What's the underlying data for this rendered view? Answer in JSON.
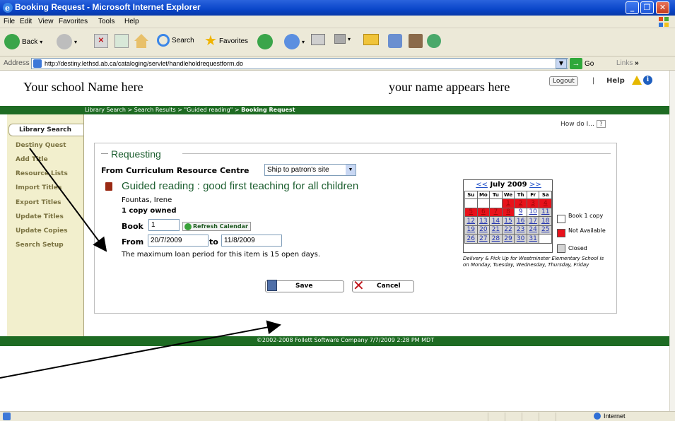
{
  "window": {
    "title": "Booking Request - Microsoft Internet Explorer",
    "controls": [
      "_",
      "❐",
      "✕"
    ]
  },
  "menu": [
    "File",
    "Edit",
    "View",
    "Favorites",
    "Tools",
    "Help"
  ],
  "toolbar": {
    "back": "Back",
    "search": "Search",
    "favorites": "Favorites"
  },
  "address": {
    "label": "Address",
    "url": "http://destiny.lethsd.ab.ca/cataloging/servlet/handleholdrequestform.do",
    "go": "Go",
    "links": "Links"
  },
  "header": {
    "school_name": "Your school Name here",
    "user_name": "your name appears here",
    "logout": "Logout",
    "separator": "|",
    "help": "Help"
  },
  "breadcrumb": {
    "trail": "Library Search > Search Results > \"Guided reading\" > ",
    "current": "Booking Request"
  },
  "sidebar": {
    "active": "Library Search",
    "items": [
      "Destiny Quest",
      "Add Title",
      "Resource Lists",
      "Import Titles",
      "Export Titles",
      "Update Titles",
      "Update Copies",
      "Search Setup"
    ]
  },
  "how_do_i": "How do I...",
  "how_do_i_icon": "?",
  "form": {
    "section": "Requesting",
    "from_curriculum": "From Curriculum Resource Centre",
    "ship_option": "Ship to patron's site",
    "book_title": "Guided reading : good first teaching for all children",
    "author": "Fountas, Irene",
    "copies_owned": "1 copy owned",
    "book_label": "Book",
    "book_value": "1",
    "refresh_label": "Refresh Calendar",
    "from_label": "From",
    "from_value": "20/7/2009",
    "to_label": "to",
    "to_value": "11/8/2009",
    "loan_message": "The maximum loan period for this item is 15 open days.",
    "save": "Save",
    "cancel": "Cancel"
  },
  "calendar": {
    "prev": "<<",
    "month": "July 2009",
    "next": ">>",
    "weekdays": [
      "Su",
      "Mo",
      "Tu",
      "We",
      "Th",
      "Fr",
      "Sa"
    ],
    "weeks": [
      [
        {
          "d": "",
          "s": "emp"
        },
        {
          "d": "",
          "s": "emp"
        },
        {
          "d": "",
          "s": "emp"
        },
        {
          "d": "1",
          "s": "na"
        },
        {
          "d": "2",
          "s": "na"
        },
        {
          "d": "3",
          "s": "na"
        },
        {
          "d": "4",
          "s": "na"
        }
      ],
      [
        {
          "d": "5",
          "s": "na"
        },
        {
          "d": "6",
          "s": "na"
        },
        {
          "d": "7",
          "s": "na"
        },
        {
          "d": "8",
          "s": "na"
        },
        {
          "d": "9",
          "s": "av"
        },
        {
          "d": "10",
          "s": "av"
        },
        {
          "d": "11",
          "s": "cl"
        }
      ],
      [
        {
          "d": "12",
          "s": "cl"
        },
        {
          "d": "13",
          "s": "cl"
        },
        {
          "d": "14",
          "s": "cl"
        },
        {
          "d": "15",
          "s": "cl"
        },
        {
          "d": "16",
          "s": "cl"
        },
        {
          "d": "17",
          "s": "cl"
        },
        {
          "d": "18",
          "s": "cl"
        }
      ],
      [
        {
          "d": "19",
          "s": "cl"
        },
        {
          "d": "20",
          "s": "cl"
        },
        {
          "d": "21",
          "s": "cl"
        },
        {
          "d": "22",
          "s": "cl"
        },
        {
          "d": "23",
          "s": "cl"
        },
        {
          "d": "24",
          "s": "cl"
        },
        {
          "d": "25",
          "s": "cl"
        }
      ],
      [
        {
          "d": "26",
          "s": "cl"
        },
        {
          "d": "27",
          "s": "cl"
        },
        {
          "d": "28",
          "s": "cl"
        },
        {
          "d": "29",
          "s": "cl"
        },
        {
          "d": "30",
          "s": "cl"
        },
        {
          "d": "31",
          "s": "cl"
        },
        {
          "d": "",
          "s": "emp"
        }
      ]
    ],
    "legend": {
      "book_copy": "Book 1 copy",
      "not_available": "Not Available",
      "closed": "Closed"
    },
    "delivery_note": "Delivery & Pick Up for Westminster Elementary School is on Monday, Tuesday, Wednesday, Thursday, Friday"
  },
  "footer": "©2002-2008 Follett Software Company    7/7/2009 2:28 PM MDT",
  "status": {
    "zone": "Internet"
  },
  "colors": {
    "brand_green": "#1e6b23",
    "sidebar_bg": "#f2efcd",
    "not_available": "#e8121b",
    "closed": "#d4d4d4"
  }
}
